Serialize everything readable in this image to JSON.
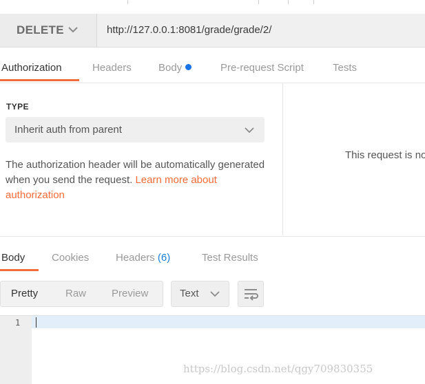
{
  "request": {
    "method": "DELETE",
    "url": "http://127.0.0.1:8081/grade/grade/2/"
  },
  "request_tabs": {
    "authorization": "Authorization",
    "headers": "Headers",
    "body": "Body",
    "prerequest": "Pre-request Script",
    "tests": "Tests"
  },
  "auth": {
    "type_label": "TYPE",
    "selected_type": "Inherit auth from parent",
    "description": "The authorization header will be automatically generated when you send the request. ",
    "learn_more": "Learn more about authorization",
    "right_notice": "This request is no"
  },
  "response_tabs": {
    "body": "Body",
    "cookies": "Cookies",
    "headers": "Headers",
    "headers_count": "(6)",
    "test_results": "Test Results"
  },
  "format": {
    "pretty": "Pretty",
    "raw": "Raw",
    "preview": "Preview",
    "type": "Text"
  },
  "editor": {
    "line_number": "1"
  },
  "watermark": "https://blog.csdn.net/qgy709830355",
  "colors": {
    "accent": "#f26b3a",
    "body_dot": "#1a73e8",
    "count": "#1a7fd6"
  }
}
